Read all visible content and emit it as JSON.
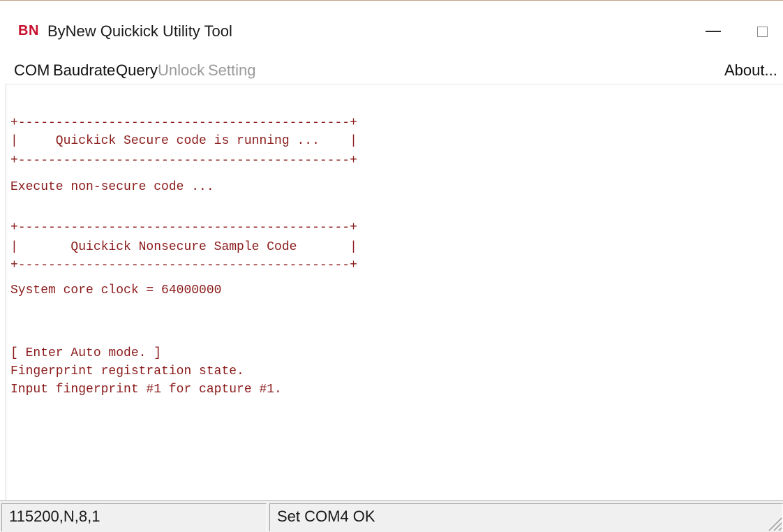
{
  "window": {
    "logo": "BN",
    "title": "ByNew Quickick Utility Tool"
  },
  "menu": {
    "items": [
      {
        "label": "COM",
        "enabled": true
      },
      {
        "label": "Baudrate",
        "enabled": true
      },
      {
        "label": "Query",
        "enabled": true
      },
      {
        "label": "Unlock",
        "enabled": false
      },
      {
        "label": "Setting",
        "enabled": false
      }
    ],
    "about": "About..."
  },
  "console": {
    "text_color": "#8b1a1a",
    "lines": [
      "+--------------------------------------------+",
      "|     Quickick Secure code is running ...    |",
      "+--------------------------------------------+",
      "Execute non-secure code ...",
      "+--------------------------------------------+",
      "|       Quickick Nonsecure Sample Code       |",
      "+--------------------------------------------+",
      "System core clock = 64000000",
      "[ Enter Auto mode. ]",
      "Fingerprint registration state.",
      "Input fingerprint #1 for capture #1."
    ]
  },
  "status": {
    "settings": "115200,N,8,1",
    "message": "Set COM4 OK"
  },
  "icons": {
    "minimize": "minimize-icon",
    "maximize": "maximize-icon",
    "close": "close-icon",
    "resize": "resize-grip-icon"
  },
  "colors": {
    "logo": "#c8102e",
    "disabled_menu": "#9a9a9a"
  }
}
